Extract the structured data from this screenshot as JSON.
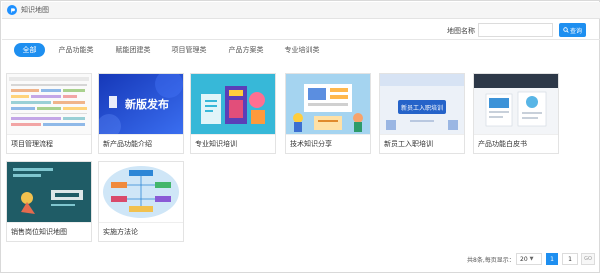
{
  "window": {
    "title": "知识地图"
  },
  "search": {
    "label": "地图名称",
    "value": "",
    "placeholder": "",
    "button_label": "查询"
  },
  "tabs": [
    {
      "label": "全部",
      "active": true
    },
    {
      "label": "产品功能类",
      "active": false
    },
    {
      "label": "赋能团建类",
      "active": false
    },
    {
      "label": "项目管理类",
      "active": false
    },
    {
      "label": "产品方案类",
      "active": false
    },
    {
      "label": "专业培训类",
      "active": false
    }
  ],
  "cards": [
    {
      "caption": "项目管理流程"
    },
    {
      "caption": "新产品功能介绍",
      "thumb_text": "新版发布"
    },
    {
      "caption": "专业知识培训"
    },
    {
      "caption": "技术知识分享"
    },
    {
      "caption": "新员工入职培训",
      "thumb_text": "新员工入职培训"
    },
    {
      "caption": "产品功能白皮书"
    },
    {
      "caption": "销售岗位知识地图"
    },
    {
      "caption": "实施方法论"
    }
  ],
  "pagination": {
    "total_text": "共8条,每页显示：",
    "page_size": "20",
    "current_page": "1",
    "goto_value": "1",
    "go_label": "GO"
  },
  "colors": {
    "accent": "#1e8ff0"
  }
}
